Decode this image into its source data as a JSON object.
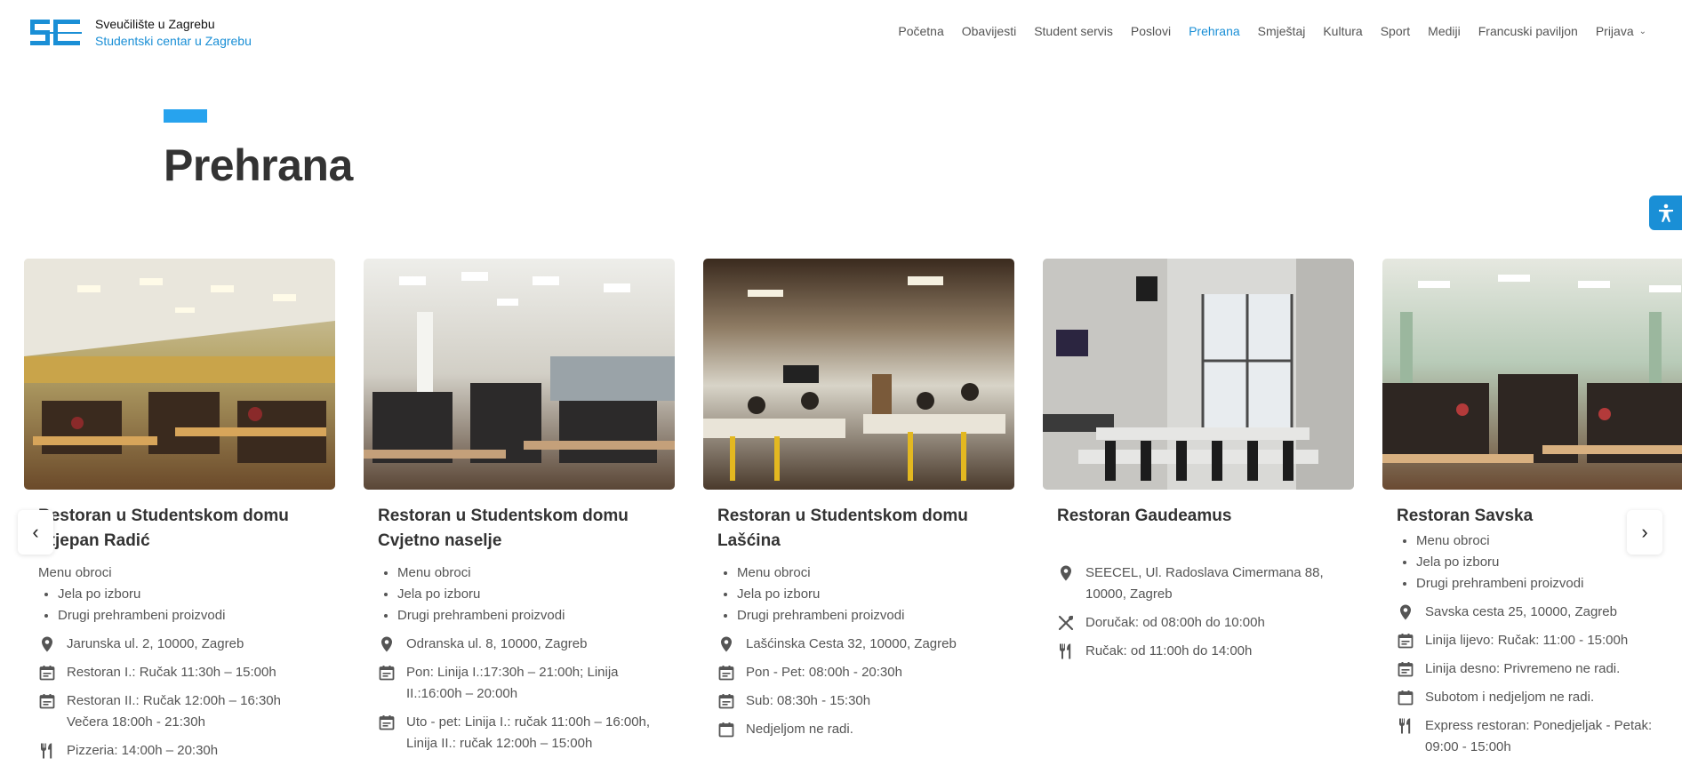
{
  "brand": {
    "line1": "Sveučilište u Zagrebu",
    "line2": "Studentski centar u Zagrebu",
    "logo_color": "#1a8fd6"
  },
  "nav": {
    "items": [
      "Početna",
      "Obavijesti",
      "Student servis",
      "Poslovi",
      "Prehrana",
      "Smještaj",
      "Kultura",
      "Sport",
      "Mediji",
      "Francuski paviljon"
    ],
    "active": "Prehrana",
    "login": "Prijava"
  },
  "page": {
    "title": "Prehrana",
    "accent_color": "#27a3ee"
  },
  "cards": [
    {
      "title": "Restoran u Studentskom domu Stjepan Radić",
      "sub": "Menu obroci",
      "list": [
        "Jela po izboru",
        "Drugi prehrambeni proizvodi"
      ],
      "info": [
        {
          "icon": "location-icon",
          "text": "Jarunska ul. 2, 10000, Zagreb"
        },
        {
          "icon": "calendar-icon",
          "text": "Restoran I.: Ručak 11:30h – 15:00h"
        },
        {
          "icon": "calendar-icon",
          "text": "Restoran II.: Ručak 12:00h – 16:30h Večera 18:00h - 21:30h"
        },
        {
          "icon": "fork-knife-icon",
          "text": "Pizzeria: 14:00h – 20:30h"
        }
      ]
    },
    {
      "title": "Restoran u Studentskom domu Cvjetno naselje",
      "list": [
        "Menu obroci",
        "Jela po izboru",
        "Drugi prehrambeni proizvodi"
      ],
      "info": [
        {
          "icon": "location-icon",
          "text": "Odranska ul. 8, 10000, Zagreb"
        },
        {
          "icon": "calendar-icon",
          "text": "Pon: Linija I.:17:30h – 21:00h; Linija II.:16:00h – 20:00h"
        },
        {
          "icon": "calendar-icon",
          "text": "Uto - pet: Linija I.: ručak 11:00h – 16:00h, Linija II.: ručak 12:00h – 15:00h"
        }
      ]
    },
    {
      "title": "Restoran u Studentskom domu Lašćina",
      "list": [
        "Menu obroci",
        "Jela po izboru",
        "Drugi prehrambeni proizvodi"
      ],
      "info": [
        {
          "icon": "location-icon",
          "text": "Lašćinska Cesta 32, 10000, Zagreb"
        },
        {
          "icon": "calendar-icon",
          "text": "Pon - Pet: 08:00h - 20:30h"
        },
        {
          "icon": "calendar-icon",
          "text": "Sub: 08:30h - 15:30h"
        },
        {
          "icon": "calendar-blank-icon",
          "text": "Nedjeljom ne radi."
        }
      ]
    },
    {
      "title": "Restoran Gaudeamus",
      "info": [
        {
          "icon": "location-icon",
          "text": "SEECEL, Ul. Radoslava Cimermana 88, 10000, Zagreb"
        },
        {
          "icon": "cutlery-cross-icon",
          "text": "Doručak: od 08:00h do 10:00h"
        },
        {
          "icon": "fork-knife-icon",
          "text": "Ručak: od 11:00h do 14:00h"
        }
      ]
    },
    {
      "title": "Restoran Savska",
      "list": [
        "Menu obroci",
        "Jela po izboru",
        "Drugi prehrambeni proizvodi"
      ],
      "info": [
        {
          "icon": "location-icon",
          "text": "Savska cesta 25, 10000, Zagreb"
        },
        {
          "icon": "calendar-icon",
          "text": "Linija lijevo: Ručak: 11:00 - 15:00h"
        },
        {
          "icon": "calendar-icon",
          "text": "Linija desno: Privremeno ne radi."
        },
        {
          "icon": "calendar-blank-icon",
          "text": "Subotom i nedjeljom ne radi."
        },
        {
          "icon": "fork-knife-icon",
          "text": "Express restoran: Ponedjeljak - Petak: 09:00 - 15:00h"
        }
      ]
    }
  ],
  "carousel": {
    "prev": "‹",
    "next": "›"
  }
}
